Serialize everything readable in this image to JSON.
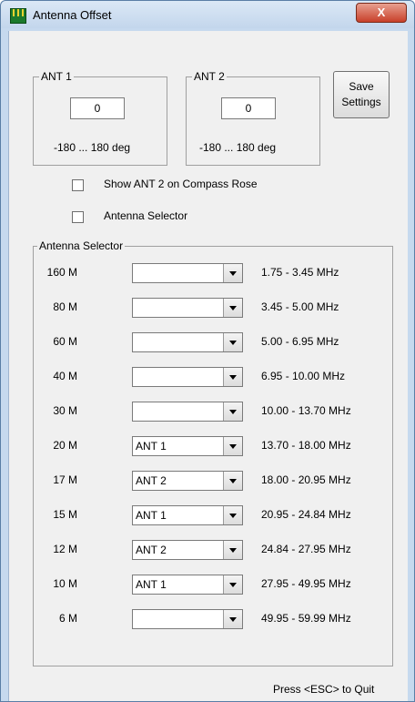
{
  "window": {
    "title": "Antenna Offset",
    "close_label": "X"
  },
  "ant1": {
    "label": "ANT 1",
    "value": "0",
    "range": "-180 ... 180 deg"
  },
  "ant2": {
    "label": "ANT 2",
    "value": "0",
    "range": "-180 ... 180 deg"
  },
  "save_button": {
    "line1": "Save",
    "line2": "Settings"
  },
  "checkboxes": {
    "show_ant2": {
      "label": "Show ANT 2 on Compass Rose",
      "checked": false
    },
    "antenna_selector": {
      "label": "Antenna Selector",
      "checked": false
    }
  },
  "selector": {
    "title": "Antenna Selector",
    "rows": [
      {
        "band": "160 M",
        "antenna": "",
        "range": "1.75 - 3.45 MHz"
      },
      {
        "band": "80 M",
        "antenna": "",
        "range": "3.45 - 5.00 MHz"
      },
      {
        "band": "60 M",
        "antenna": "",
        "range": "5.00 - 6.95 MHz"
      },
      {
        "band": "40 M",
        "antenna": "",
        "range": "6.95 - 10.00 MHz"
      },
      {
        "band": "30 M",
        "antenna": "",
        "range": "10.00 - 13.70 MHz"
      },
      {
        "band": "20 M",
        "antenna": "ANT 1",
        "range": "13.70 - 18.00 MHz"
      },
      {
        "band": "17 M",
        "antenna": "ANT 2",
        "range": "18.00 - 20.95 MHz"
      },
      {
        "band": "15 M",
        "antenna": "ANT 1",
        "range": "20.95 - 24.84 MHz"
      },
      {
        "band": "12 M",
        "antenna": "ANT 2",
        "range": "24.84 - 27.95 MHz"
      },
      {
        "band": "10 M",
        "antenna": "ANT 1",
        "range": "27.95 - 49.95 MHz"
      },
      {
        "band": "6 M",
        "antenna": "",
        "range": "49.95 - 59.99 MHz"
      }
    ]
  },
  "status": {
    "text": "Press <ESC> to Quit"
  }
}
